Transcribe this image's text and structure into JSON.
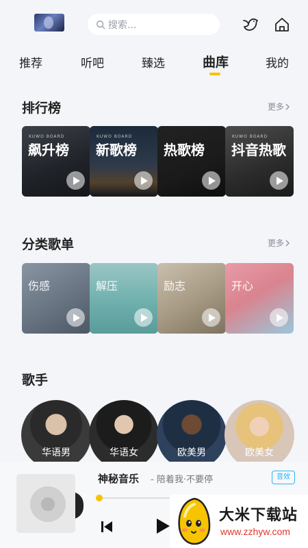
{
  "header": {
    "search_placeholder": "搜索...",
    "icons": [
      "avatar",
      "search-icon",
      "bird-icon",
      "home-icon"
    ]
  },
  "tabs": [
    {
      "label": "推荐",
      "active": false
    },
    {
      "label": "听吧",
      "active": false
    },
    {
      "label": "臻选",
      "active": false
    },
    {
      "label": "曲库",
      "active": true
    },
    {
      "label": "我的",
      "active": false
    }
  ],
  "charts": {
    "title": "排行榜",
    "more": "更多",
    "items": [
      {
        "label": "飙升榜",
        "brand": "KUWO BOARD"
      },
      {
        "label": "新歌榜",
        "brand": "KUWO BOARD"
      },
      {
        "label": "热歌榜",
        "brand": ""
      },
      {
        "label": "抖音热歌",
        "brand": "KUWO BOARD"
      }
    ]
  },
  "categories": {
    "title": "分类歌单",
    "more": "更多",
    "items": [
      {
        "label": "伤感"
      },
      {
        "label": "解压"
      },
      {
        "label": "励志"
      },
      {
        "label": "开心"
      }
    ]
  },
  "singers": {
    "title": "歌手",
    "items": [
      {
        "label": "华语男"
      },
      {
        "label": "华语女"
      },
      {
        "label": "欧美男"
      },
      {
        "label": "欧美女"
      }
    ]
  },
  "player": {
    "title": "神秘音乐",
    "subtitle": "- 陪着我·不要停",
    "quality": "音效",
    "progress": 0.02
  },
  "watermark": {
    "title": "大米下载站",
    "url": "www.zzhyw.com"
  },
  "colors": {
    "accent": "#f5c400",
    "quality_blue": "#29b6f6",
    "watermark_red": "#e0362c"
  }
}
